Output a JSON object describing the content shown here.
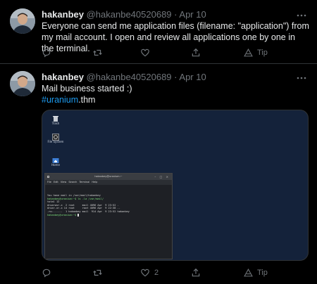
{
  "tweets": [
    {
      "author_name": "hakanbey",
      "handle": "@hakanbe40520689",
      "separator": "·",
      "date": "Apr 10",
      "more_icon": "more-icon",
      "text": "Everyone can send me application files (filename: \"application\") from my mail account. I open and review all applications one by one in the terminal.",
      "actions": {
        "reply": {
          "icon": "reply-icon",
          "count": ""
        },
        "retweet": {
          "icon": "retweet-icon",
          "count": ""
        },
        "like": {
          "icon": "like-icon",
          "count": ""
        },
        "share": {
          "icon": "share-icon"
        },
        "tip": {
          "icon": "tip-icon",
          "label": "Tip"
        }
      }
    },
    {
      "author_name": "hakanbey",
      "handle": "@hakanbe40520689",
      "separator": "·",
      "date": "Apr 10",
      "more_icon": "more-icon",
      "text": "Mail business started :)",
      "hashtag": "#uranium",
      "hashtag_suffix": ".thm",
      "media": {
        "desktop_icons": [
          {
            "icon": "trash-icon",
            "label": "Trash"
          },
          {
            "icon": "file-system-icon",
            "label": "File System"
          },
          {
            "icon": "home-folder-icon",
            "label": "Home"
          }
        ],
        "terminal": {
          "title": "hakanbey@uranium:~",
          "menu": [
            "File",
            "Edit",
            "View",
            "Search",
            "Terminal",
            "Help"
          ],
          "lines": [
            "You have mail in /var/mail/hakanbey",
            "hakanbey@uranium:~$ ls -la /var/mail/",
            "total 12",
            "drwxrwsr-x  2 root     mail 4096 Apr  9 23:52 .",
            "drwxr-xr-x 14 root     root 4096 Apr  9 22:38 ..",
            "-rw-------  1 hakanbey mail  914 Apr  9 23:52 hakanbey",
            "hakanbey@uranium:~$ "
          ]
        }
      },
      "actions": {
        "reply": {
          "icon": "reply-icon",
          "count": ""
        },
        "retweet": {
          "icon": "retweet-icon",
          "count": ""
        },
        "like": {
          "icon": "like-icon",
          "count": "2"
        },
        "share": {
          "icon": "share-icon"
        },
        "tip": {
          "icon": "tip-icon",
          "label": "Tip"
        }
      }
    }
  ],
  "colors": {
    "background": "#000000",
    "border": "#2f3336",
    "text": "#e7e9ea",
    "muted": "#71767b",
    "link": "#1d9bf0",
    "desktop_bg": "#14223a"
  }
}
